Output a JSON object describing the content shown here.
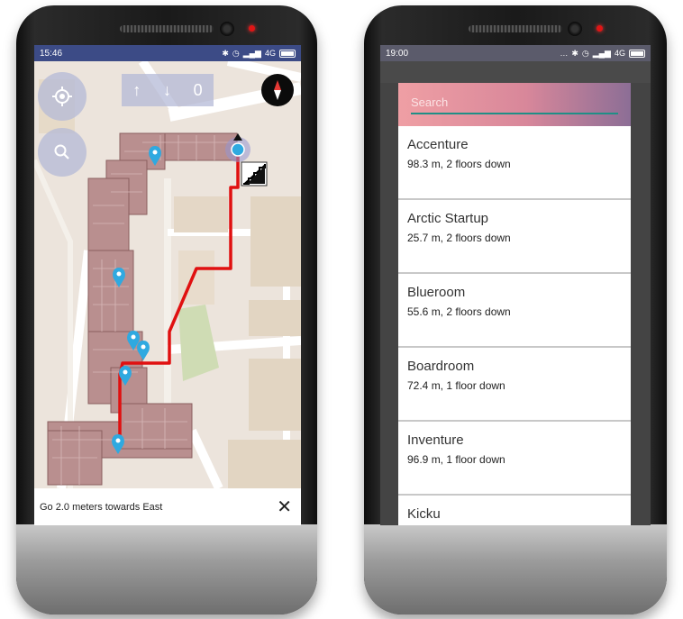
{
  "left_screen": {
    "status_time": "15:46",
    "status_network": "4G",
    "floor_control": {
      "up_arrow": "↑",
      "down_arrow": "↓",
      "floor_number": "0"
    },
    "navigation_instruction": "Go 2.0 meters towards East",
    "close_symbol": "✕",
    "icons": [
      "my-location-icon",
      "search-icon",
      "compass-icon",
      "map-pin-icon",
      "close-icon"
    ]
  },
  "right_screen": {
    "status_time": "19:00",
    "status_network": "4G",
    "search_placeholder": "Search",
    "results": [
      {
        "name": "Accenture",
        "detail": "98.3 m, 2 floors down"
      },
      {
        "name": "Arctic Startup",
        "detail": "25.7 m, 2 floors down"
      },
      {
        "name": "Blueroom",
        "detail": "55.6 m, 2 floors down"
      },
      {
        "name": "Boardroom",
        "detail": "72.4 m, 1 floor down"
      },
      {
        "name": "Inventure",
        "detail": "96.9 m, 1 floor down"
      },
      {
        "name": "Kicku",
        "detail": ""
      }
    ]
  },
  "colors": {
    "status_bar_left": "#3c4b86",
    "route_line": "#e01010",
    "building_fill": "#b98f8f",
    "map_pin": "#2fa9e0",
    "search_gradient_start": "#ef9fa4",
    "search_gradient_end": "#8c6e96",
    "search_underline": "#1f8f86"
  }
}
